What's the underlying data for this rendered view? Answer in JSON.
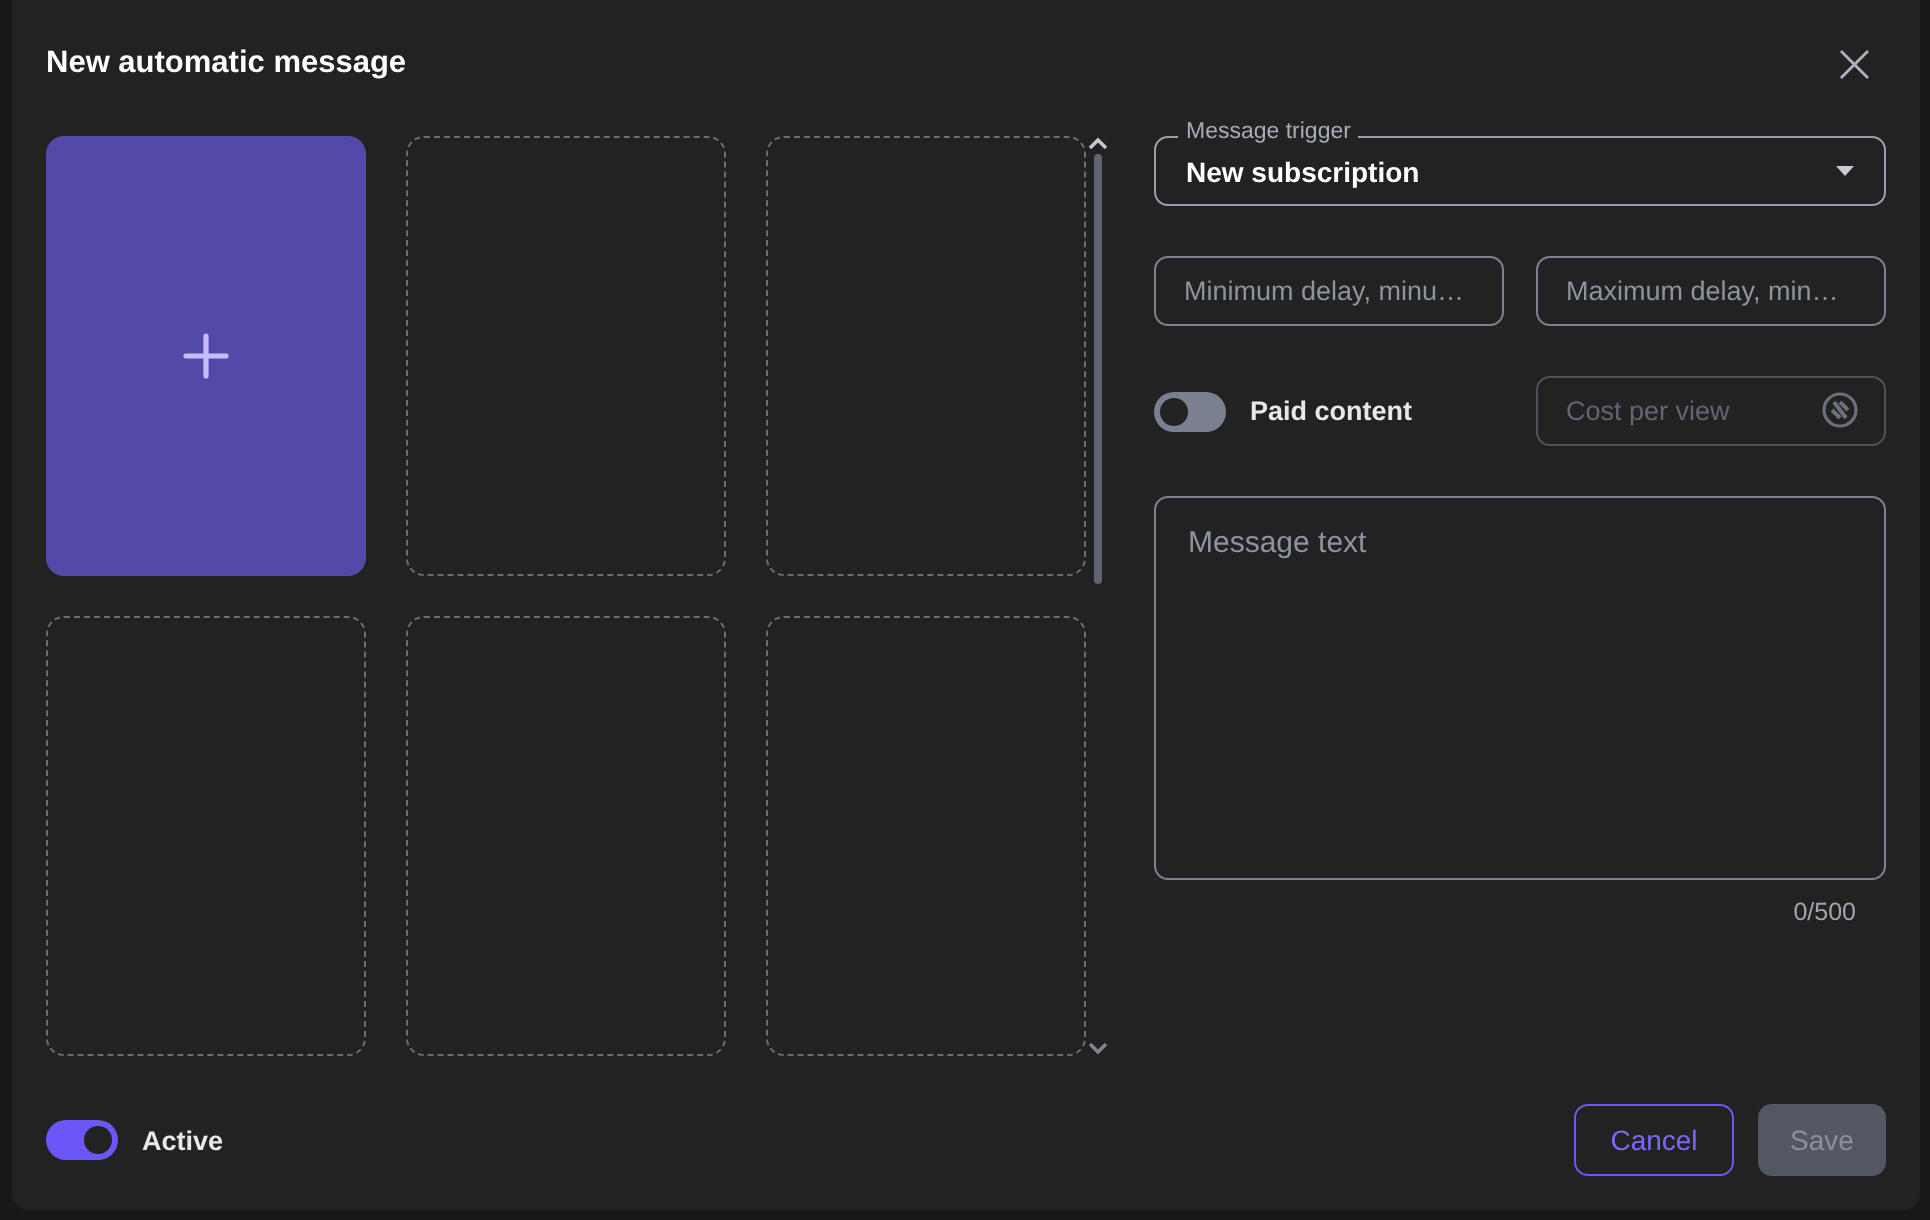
{
  "dialog": {
    "title": "New automatic message",
    "close": "×"
  },
  "media_slots": [
    {
      "kind": "add"
    },
    {
      "kind": "empty"
    },
    {
      "kind": "empty"
    },
    {
      "kind": "empty"
    },
    {
      "kind": "empty"
    },
    {
      "kind": "empty"
    }
  ],
  "trigger": {
    "label": "Message trigger",
    "value": "New subscription"
  },
  "min_delay": {
    "placeholder": "Minimum delay, minu…"
  },
  "max_delay": {
    "placeholder": "Maximum delay, min…"
  },
  "paid_content": {
    "label": "Paid content",
    "on": false
  },
  "cost": {
    "placeholder": "Cost per view",
    "disabled": true
  },
  "message": {
    "placeholder": "Message text",
    "counter": "0/500"
  },
  "active": {
    "label": "Active",
    "on": true
  },
  "buttons": [
    {
      "kind": "outline",
      "label": "Cancel",
      "disabled": false
    },
    {
      "kind": "filled",
      "label": "Save",
      "disabled": true
    }
  ]
}
